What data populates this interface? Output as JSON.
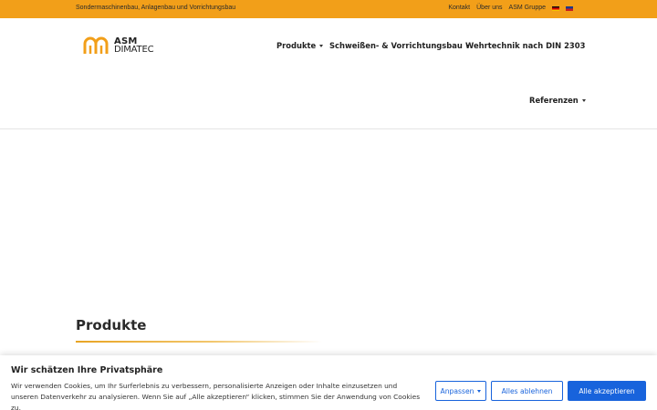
{
  "topbar": {
    "tagline": "Sondermaschinenbau, Anlagenbau und Vorrichtungsbau",
    "links": [
      "Kontakt",
      "Über uns",
      "ASM Gruppe"
    ],
    "languages": [
      "de-flag-icon",
      "en-flag-icon"
    ]
  },
  "logo": {
    "line1": "ASM",
    "line2": "DIMATEC"
  },
  "nav": {
    "produkte": "Produkte",
    "schweissen": "Schweißen- & Vorrichtungsbau",
    "wehrtechnik": "Wehrtechnik nach DIN 2303",
    "referenzen": "Referenzen"
  },
  "main": {
    "title": "Produkte"
  },
  "cookie": {
    "title": "Wir schätzen Ihre Privatsphäre",
    "text": "Wir verwenden Cookies, um Ihr Surferlebnis zu verbessern, personalisierte Anzeigen oder Inhalte einzusetzen und unseren Datenverkehr zu analysieren. Wenn Sie auf „Alle akzeptieren“ klicken, stimmen Sie der Anwendung von Cookies zu.",
    "customize": "Anpassen",
    "reject": "Alles ablehnen",
    "accept": "Alle akzeptieren"
  },
  "colors": {
    "accent": "#f29f19",
    "cookie_button": "#1863dc"
  }
}
